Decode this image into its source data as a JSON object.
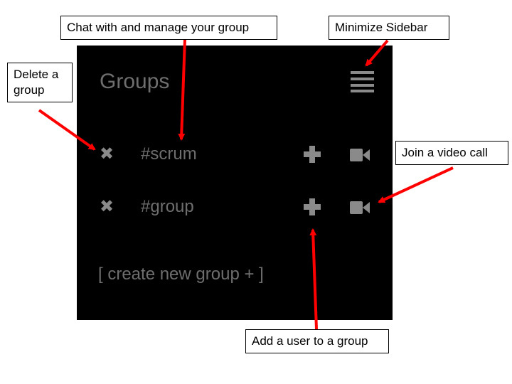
{
  "sidebar": {
    "title": "Groups",
    "menu_icon": "hamburger-icon",
    "groups": [
      {
        "delete_icon": "close-icon",
        "delete_glyph": "✖",
        "name": "#scrum",
        "add_icon": "plus-icon",
        "video_icon": "video-camera-icon"
      },
      {
        "delete_icon": "close-icon",
        "delete_glyph": "✖",
        "name": "#group",
        "add_icon": "plus-icon",
        "video_icon": "video-camera-icon"
      }
    ],
    "create_label": "[ create new group + ]"
  },
  "annotations": {
    "chat": "Chat with and manage your group",
    "minimize": "Minimize Sidebar",
    "delete": "Delete a group",
    "video": "Join a video call",
    "add_user": "Add a user to a group"
  },
  "colors": {
    "panel_bg": "#000000",
    "text_muted": "#6e6e6e",
    "icon": "#8a8a8a",
    "arrow": "#ff0000"
  }
}
